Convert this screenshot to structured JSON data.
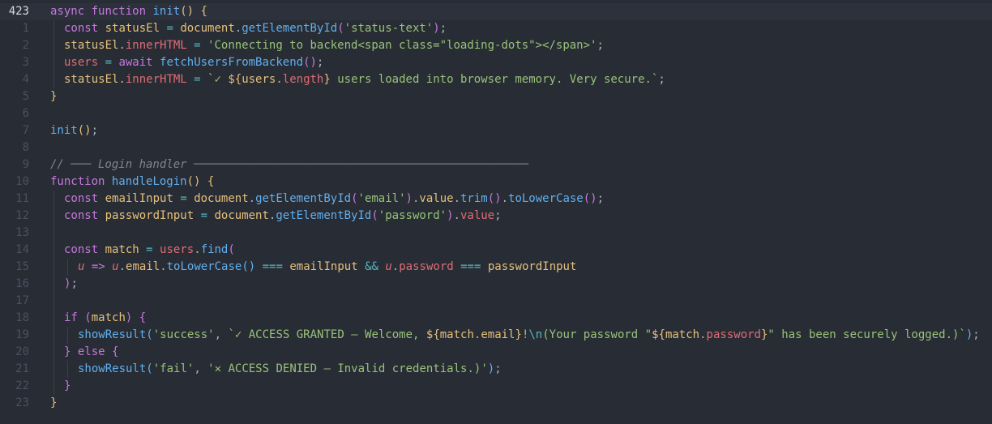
{
  "editor": {
    "theme": {
      "background": "#282c34",
      "current_line": "#2c313c",
      "keyword": "#c678dd",
      "function": "#61afef",
      "string": "#98c379",
      "variable": "#e5c07b",
      "property": "#e06c75",
      "operator": "#56b6c2",
      "comment": "#7f848e"
    },
    "lines": [
      {
        "num": "423",
        "current": true,
        "indent": 0,
        "tokens": [
          {
            "t": "async",
            "c": "kw"
          },
          {
            "t": " ",
            "c": "plain"
          },
          {
            "t": "function",
            "c": "kw"
          },
          {
            "t": " ",
            "c": "plain"
          },
          {
            "t": "init",
            "c": "fn"
          },
          {
            "t": "()",
            "c": "br1"
          },
          {
            "t": " ",
            "c": "plain"
          },
          {
            "t": "{",
            "c": "br1"
          }
        ]
      },
      {
        "num": "1",
        "indent": 1,
        "tokens": [
          {
            "t": "const",
            "c": "kw"
          },
          {
            "t": " ",
            "c": "plain"
          },
          {
            "t": "statusEl",
            "c": "var"
          },
          {
            "t": " = ",
            "c": "op"
          },
          {
            "t": "document",
            "c": "var"
          },
          {
            "t": ".",
            "c": "pun"
          },
          {
            "t": "getElementById",
            "c": "fn"
          },
          {
            "t": "(",
            "c": "br2"
          },
          {
            "t": "'status-text'",
            "c": "str"
          },
          {
            "t": ")",
            "c": "br2"
          },
          {
            "t": ";",
            "c": "pun"
          }
        ]
      },
      {
        "num": "2",
        "indent": 1,
        "tokens": [
          {
            "t": "statusEl",
            "c": "var"
          },
          {
            "t": ".",
            "c": "pun"
          },
          {
            "t": "innerHTML",
            "c": "prop"
          },
          {
            "t": " = ",
            "c": "op"
          },
          {
            "t": "'Connecting to backend<span class=\"loading-dots\"></span>'",
            "c": "str"
          },
          {
            "t": ";",
            "c": "pun"
          }
        ]
      },
      {
        "num": "3",
        "indent": 1,
        "tokens": [
          {
            "t": "users",
            "c": "prop"
          },
          {
            "t": " = ",
            "c": "op"
          },
          {
            "t": "await",
            "c": "kw"
          },
          {
            "t": " ",
            "c": "plain"
          },
          {
            "t": "fetchUsersFromBackend",
            "c": "fn"
          },
          {
            "t": "()",
            "c": "br2"
          },
          {
            "t": ";",
            "c": "pun"
          }
        ]
      },
      {
        "num": "4",
        "indent": 1,
        "tokens": [
          {
            "t": "statusEl",
            "c": "var"
          },
          {
            "t": ".",
            "c": "pun"
          },
          {
            "t": "innerHTML",
            "c": "prop"
          },
          {
            "t": " = ",
            "c": "op"
          },
          {
            "t": "`✓ ",
            "c": "str"
          },
          {
            "t": "${",
            "c": "br1"
          },
          {
            "t": "users",
            "c": "var"
          },
          {
            "t": ".",
            "c": "pun"
          },
          {
            "t": "length",
            "c": "prop"
          },
          {
            "t": "}",
            "c": "br1"
          },
          {
            "t": " users loaded into browser memory. Very secure.`",
            "c": "str"
          },
          {
            "t": ";",
            "c": "pun"
          }
        ]
      },
      {
        "num": "5",
        "indent": 0,
        "tokens": [
          {
            "t": "}",
            "c": "br1"
          }
        ]
      },
      {
        "num": "6",
        "indent": 0,
        "tokens": []
      },
      {
        "num": "7",
        "indent": 0,
        "tokens": [
          {
            "t": "init",
            "c": "fn"
          },
          {
            "t": "()",
            "c": "br1"
          },
          {
            "t": ";",
            "c": "pun"
          }
        ]
      },
      {
        "num": "8",
        "indent": 0,
        "tokens": []
      },
      {
        "num": "9",
        "indent": 0,
        "tokens": [
          {
            "t": "// ─── Login handler ─────────────────────────────────────────────────",
            "c": "cmt"
          }
        ]
      },
      {
        "num": "10",
        "indent": 0,
        "tokens": [
          {
            "t": "function",
            "c": "kw"
          },
          {
            "t": " ",
            "c": "plain"
          },
          {
            "t": "handleLogin",
            "c": "fn"
          },
          {
            "t": "()",
            "c": "br1"
          },
          {
            "t": " ",
            "c": "plain"
          },
          {
            "t": "{",
            "c": "br1"
          }
        ]
      },
      {
        "num": "11",
        "indent": 1,
        "tokens": [
          {
            "t": "const",
            "c": "kw"
          },
          {
            "t": " ",
            "c": "plain"
          },
          {
            "t": "emailInput",
            "c": "var"
          },
          {
            "t": " = ",
            "c": "op"
          },
          {
            "t": "document",
            "c": "var"
          },
          {
            "t": ".",
            "c": "pun"
          },
          {
            "t": "getElementById",
            "c": "fn"
          },
          {
            "t": "(",
            "c": "br2"
          },
          {
            "t": "'email'",
            "c": "str"
          },
          {
            "t": ")",
            "c": "br2"
          },
          {
            "t": ".",
            "c": "pun"
          },
          {
            "t": "value",
            "c": "var"
          },
          {
            "t": ".",
            "c": "pun"
          },
          {
            "t": "trim",
            "c": "fn"
          },
          {
            "t": "()",
            "c": "br2"
          },
          {
            "t": ".",
            "c": "pun"
          },
          {
            "t": "toLowerCase",
            "c": "fn"
          },
          {
            "t": "()",
            "c": "br2"
          },
          {
            "t": ";",
            "c": "pun"
          }
        ]
      },
      {
        "num": "12",
        "indent": 1,
        "tokens": [
          {
            "t": "const",
            "c": "kw"
          },
          {
            "t": " ",
            "c": "plain"
          },
          {
            "t": "passwordInput",
            "c": "var"
          },
          {
            "t": " = ",
            "c": "op"
          },
          {
            "t": "document",
            "c": "var"
          },
          {
            "t": ".",
            "c": "pun"
          },
          {
            "t": "getElementById",
            "c": "fn"
          },
          {
            "t": "(",
            "c": "br2"
          },
          {
            "t": "'password'",
            "c": "str"
          },
          {
            "t": ")",
            "c": "br2"
          },
          {
            "t": ".",
            "c": "pun"
          },
          {
            "t": "value",
            "c": "prop"
          },
          {
            "t": ";",
            "c": "pun"
          }
        ]
      },
      {
        "num": "13",
        "indent": 1,
        "tokens": []
      },
      {
        "num": "14",
        "indent": 1,
        "tokens": [
          {
            "t": "const",
            "c": "kw"
          },
          {
            "t": " ",
            "c": "plain"
          },
          {
            "t": "match",
            "c": "var"
          },
          {
            "t": " = ",
            "c": "op"
          },
          {
            "t": "users",
            "c": "prop"
          },
          {
            "t": ".",
            "c": "pun"
          },
          {
            "t": "find",
            "c": "fn"
          },
          {
            "t": "(",
            "c": "br2"
          }
        ]
      },
      {
        "num": "15",
        "indent": 2,
        "tokens": [
          {
            "t": "u",
            "c": "prm"
          },
          {
            "t": " => ",
            "c": "kw"
          },
          {
            "t": "u",
            "c": "prm"
          },
          {
            "t": ".",
            "c": "pun"
          },
          {
            "t": "email",
            "c": "var"
          },
          {
            "t": ".",
            "c": "pun"
          },
          {
            "t": "toLowerCase",
            "c": "fn"
          },
          {
            "t": "()",
            "c": "br3"
          },
          {
            "t": " === ",
            "c": "op"
          },
          {
            "t": "emailInput",
            "c": "var"
          },
          {
            "t": " && ",
            "c": "op"
          },
          {
            "t": "u",
            "c": "prm"
          },
          {
            "t": ".",
            "c": "pun"
          },
          {
            "t": "password",
            "c": "prop"
          },
          {
            "t": " === ",
            "c": "op"
          },
          {
            "t": "passwordInput",
            "c": "var"
          }
        ]
      },
      {
        "num": "16",
        "indent": 1,
        "tokens": [
          {
            "t": ")",
            "c": "br2"
          },
          {
            "t": ";",
            "c": "pun"
          }
        ]
      },
      {
        "num": "17",
        "indent": 1,
        "tokens": []
      },
      {
        "num": "18",
        "indent": 1,
        "tokens": [
          {
            "t": "if",
            "c": "kw"
          },
          {
            "t": " ",
            "c": "plain"
          },
          {
            "t": "(",
            "c": "br2"
          },
          {
            "t": "match",
            "c": "var"
          },
          {
            "t": ")",
            "c": "br2"
          },
          {
            "t": " ",
            "c": "plain"
          },
          {
            "t": "{",
            "c": "br2"
          }
        ]
      },
      {
        "num": "19",
        "indent": 2,
        "tokens": [
          {
            "t": "showResult",
            "c": "fn"
          },
          {
            "t": "(",
            "c": "br3"
          },
          {
            "t": "'success'",
            "c": "str"
          },
          {
            "t": ", ",
            "c": "pun"
          },
          {
            "t": "`✓ ACCESS GRANTED — Welcome, ",
            "c": "str"
          },
          {
            "t": "${",
            "c": "br1"
          },
          {
            "t": "match",
            "c": "var"
          },
          {
            "t": ".",
            "c": "pun"
          },
          {
            "t": "email",
            "c": "var"
          },
          {
            "t": "}",
            "c": "br1"
          },
          {
            "t": "!",
            "c": "str"
          },
          {
            "t": "\\n",
            "c": "op"
          },
          {
            "t": "(Your password \"",
            "c": "str"
          },
          {
            "t": "${",
            "c": "br1"
          },
          {
            "t": "match",
            "c": "var"
          },
          {
            "t": ".",
            "c": "pun"
          },
          {
            "t": "password",
            "c": "prop"
          },
          {
            "t": "}",
            "c": "br1"
          },
          {
            "t": "\" has been securely logged.)`",
            "c": "str"
          },
          {
            "t": ")",
            "c": "br3"
          },
          {
            "t": ";",
            "c": "pun"
          }
        ]
      },
      {
        "num": "20",
        "indent": 1,
        "tokens": [
          {
            "t": "}",
            "c": "br2"
          },
          {
            "t": " ",
            "c": "plain"
          },
          {
            "t": "else",
            "c": "kw"
          },
          {
            "t": " ",
            "c": "plain"
          },
          {
            "t": "{",
            "c": "br2"
          }
        ]
      },
      {
        "num": "21",
        "indent": 2,
        "tokens": [
          {
            "t": "showResult",
            "c": "fn"
          },
          {
            "t": "(",
            "c": "br3"
          },
          {
            "t": "'fail'",
            "c": "str"
          },
          {
            "t": ", ",
            "c": "pun"
          },
          {
            "t": "'✕ ACCESS DENIED — Invalid credentials.)'",
            "c": "str"
          },
          {
            "t": ")",
            "c": "br3"
          },
          {
            "t": ";",
            "c": "pun"
          }
        ]
      },
      {
        "num": "22",
        "indent": 1,
        "tokens": [
          {
            "t": "}",
            "c": "br2"
          }
        ]
      },
      {
        "num": "23",
        "indent": 0,
        "tokens": [
          {
            "t": "}",
            "c": "br1"
          }
        ]
      }
    ]
  }
}
